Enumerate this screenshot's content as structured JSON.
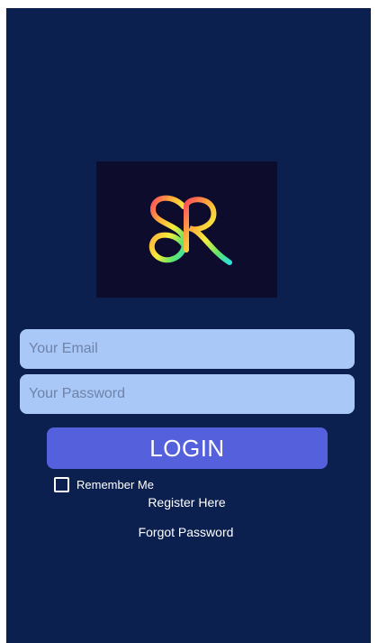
{
  "login_form": {
    "email_placeholder": "Your Email",
    "password_placeholder": "Your Password",
    "login_label": "LOGIN",
    "remember_label": "Remember Me",
    "remember_checked": false,
    "register_label": "Register Here",
    "forgot_label": "Forgot Password"
  },
  "logo": {
    "text": "SR",
    "icon": "sr-logo-icon"
  },
  "colors": {
    "background": "#0c2050",
    "logo_background": "#0d0c2c",
    "input_background": "#a9c8f7",
    "button_background": "#5560dc",
    "text_on_dark": "#ffffff"
  }
}
